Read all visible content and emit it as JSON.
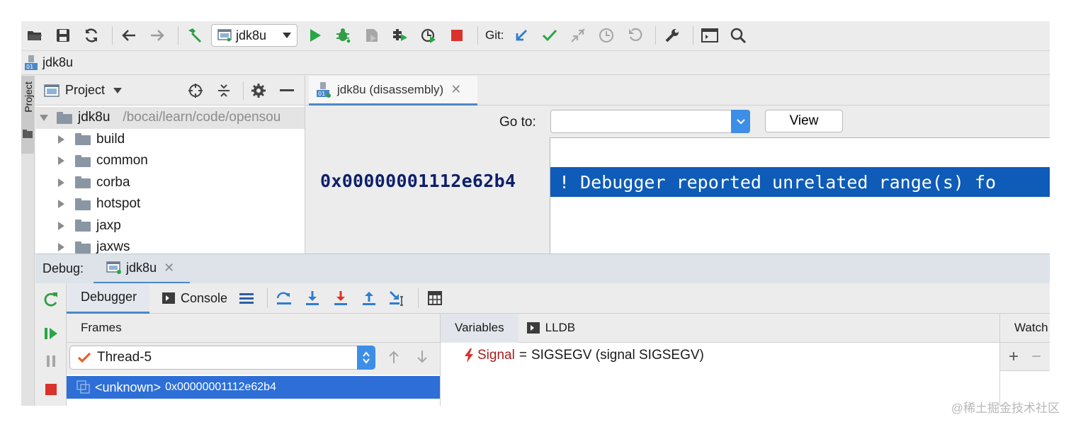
{
  "toolbar": {
    "run_config": "jdk8u",
    "git_label": "Git:"
  },
  "navbar": {
    "project_name": "jdk8u"
  },
  "left_stripe": {
    "project_label": "Project"
  },
  "project_panel": {
    "title": "Project",
    "root": {
      "name": "jdk8u",
      "path": "/bocai/learn/code/opensou"
    },
    "children": [
      {
        "name": "build"
      },
      {
        "name": "common"
      },
      {
        "name": "corba"
      },
      {
        "name": "hotspot"
      },
      {
        "name": "jaxp"
      },
      {
        "name": "jaxws"
      }
    ]
  },
  "editor": {
    "tab_title": "jdk8u (disassembly)",
    "goto_label": "Go to:",
    "goto_value": "",
    "view_button": "View",
    "address": "0x00000001112e62b4",
    "disassembly_line": "! Debugger reported unrelated range(s) fo"
  },
  "debug": {
    "label": "Debug:",
    "session_tab": "jdk8u",
    "tabs": {
      "debugger": "Debugger",
      "console": "Console"
    },
    "frames": {
      "header": "Frames",
      "thread": "Thread-5",
      "frame_function": "<unknown>",
      "frame_address": "0x00000001112e62b4"
    },
    "variables": {
      "tab_variables": "Variables",
      "tab_lldb": "LLDB",
      "var_name": "Signal",
      "var_equals": "=",
      "var_value": "SIGSEGV (signal SIGSEGV)"
    },
    "watches": {
      "header": "Watch"
    }
  },
  "watermark": "@稀土掘金技术社区",
  "colors": {
    "accent": "#4a88c7",
    "selection": "#2d6fd6",
    "disasm_highlight": "#0e5bb8",
    "run_green": "#27a745",
    "stop_red": "#d9322b",
    "git_blue": "#2d7dd2"
  }
}
